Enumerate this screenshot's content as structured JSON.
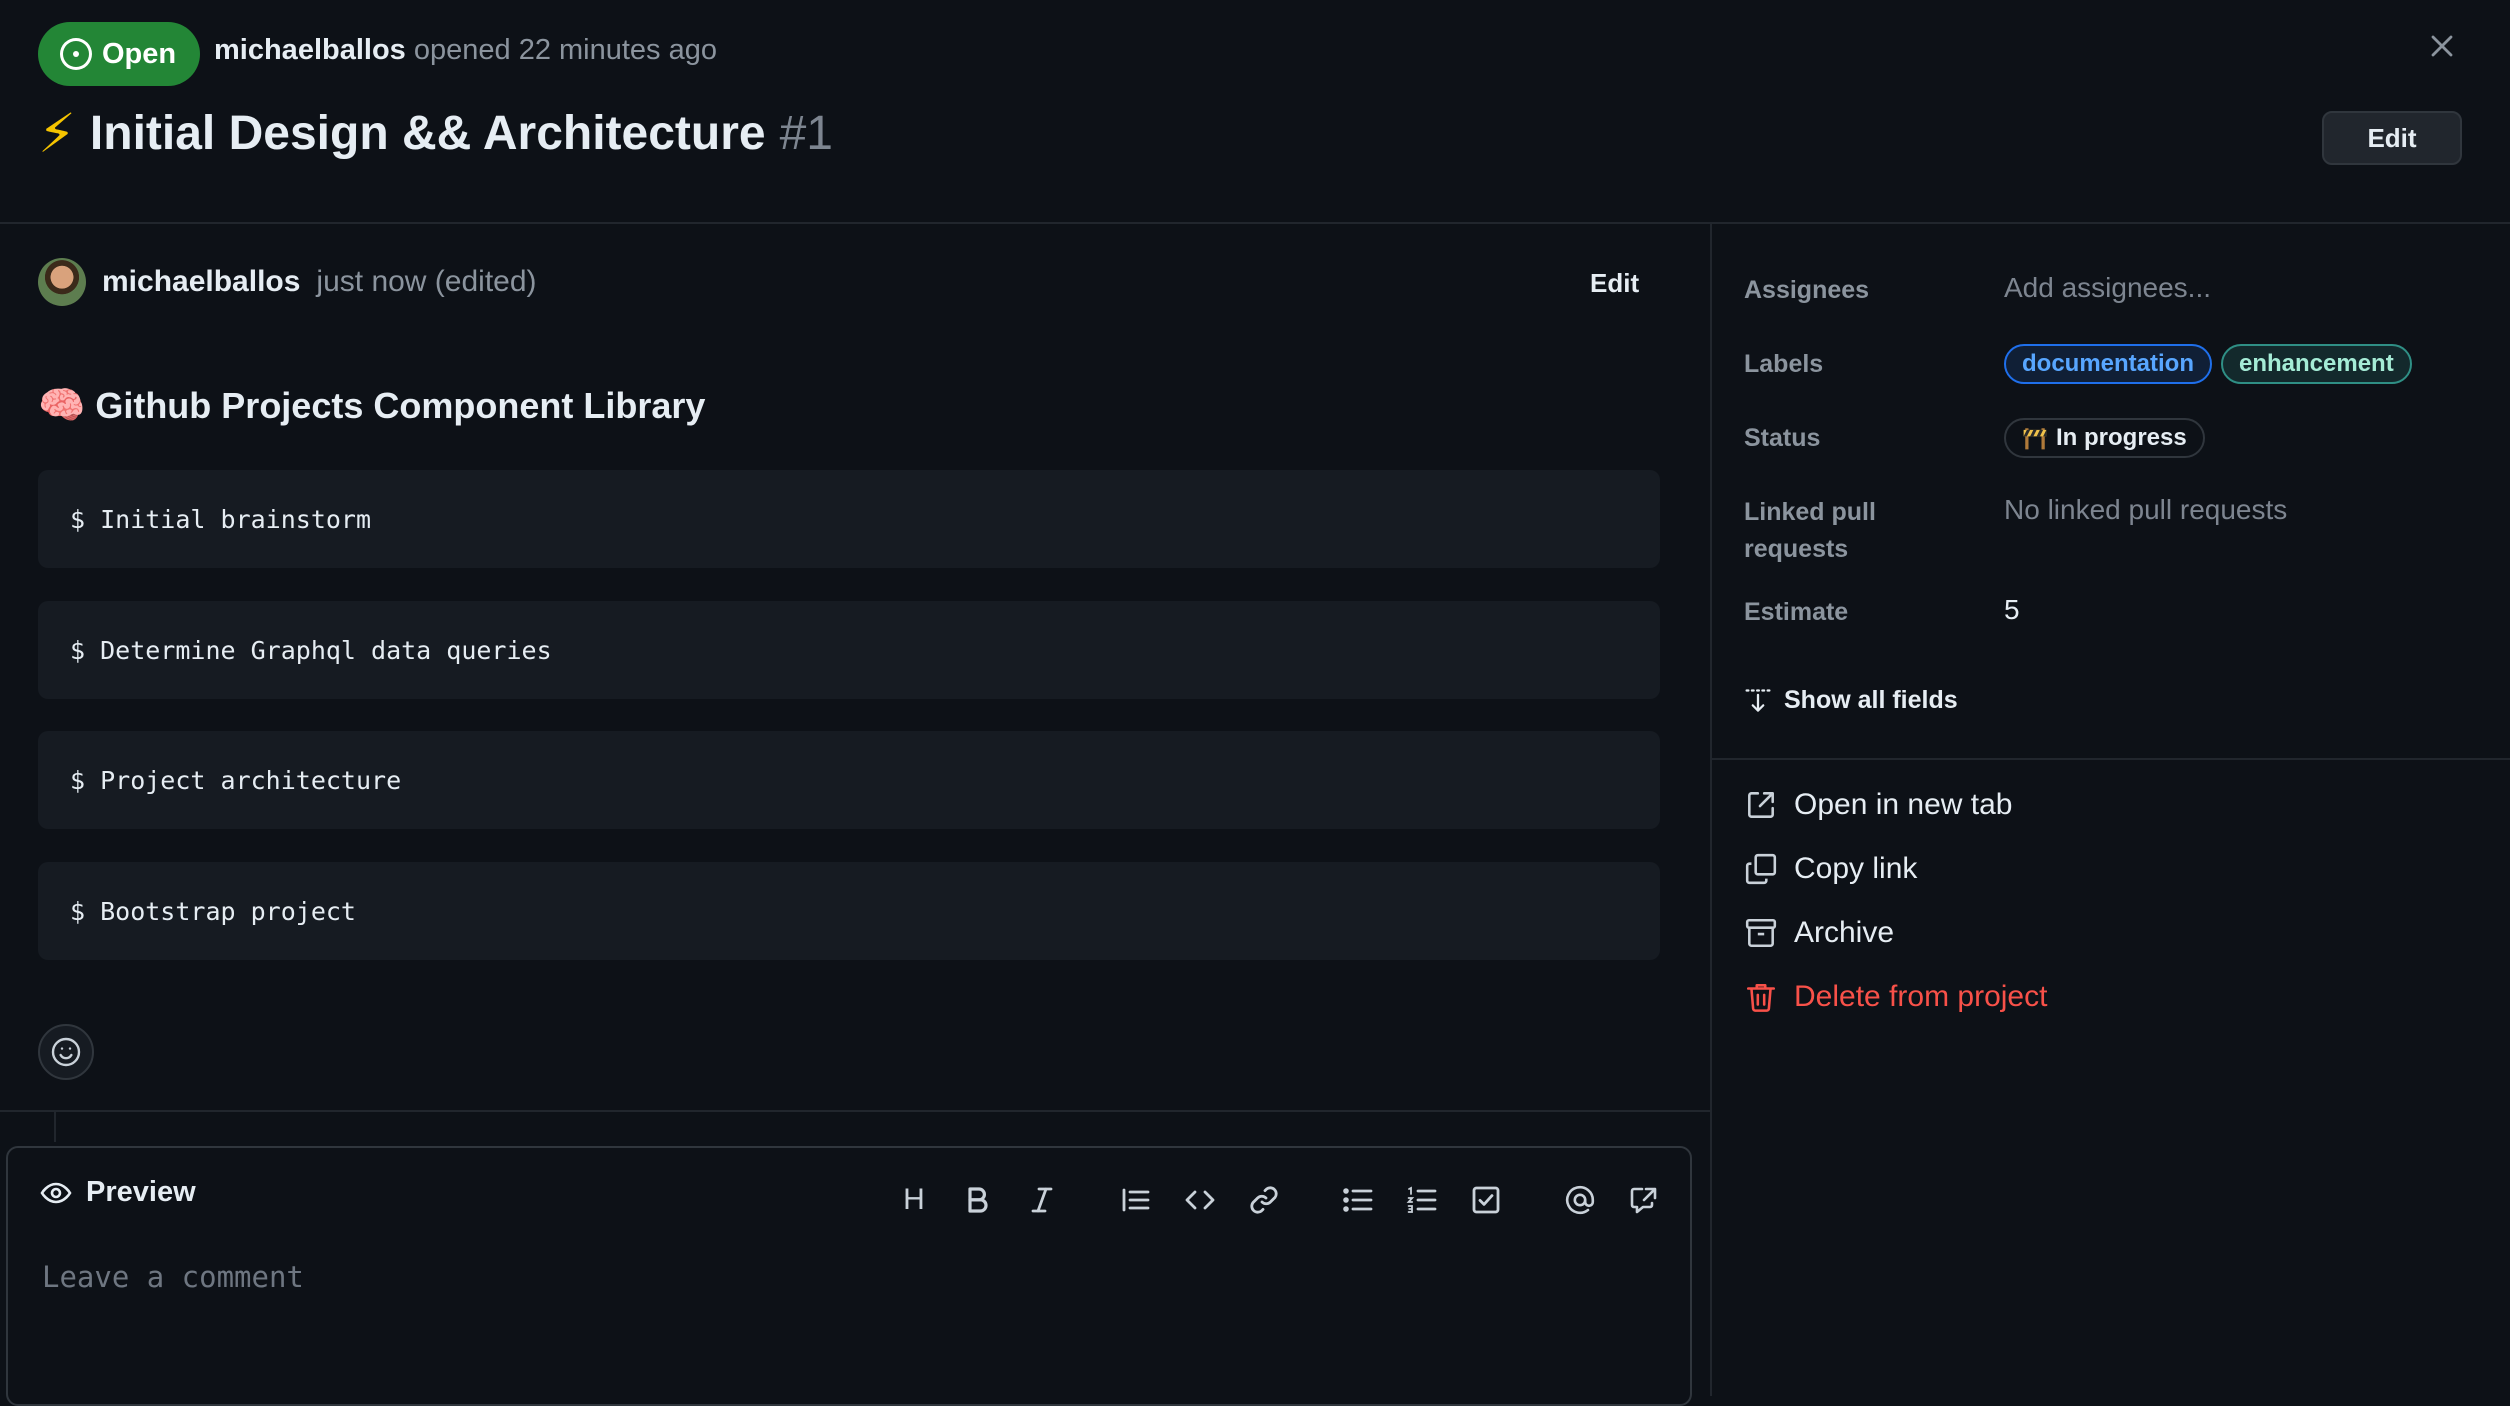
{
  "header": {
    "state_label": "Open",
    "author": "michaelballos",
    "opened_text": "opened 22 minutes ago",
    "title_emoji": "⚡",
    "title": "Initial Design && Architecture",
    "number": "#1",
    "edit_label": "Edit"
  },
  "comment": {
    "author": "michaelballos",
    "time": "just now (edited)",
    "edit_label": "Edit",
    "heading_emoji": "🧠",
    "heading": "Github Projects Component Library",
    "code_lines": [
      "$ Initial brainstorm",
      "$ Determine Graphql data queries",
      "$ Project architecture",
      "$ Bootstrap project"
    ]
  },
  "composer": {
    "preview_label": "Preview",
    "heading_tool": "H",
    "placeholder": "Leave a comment"
  },
  "sidebar": {
    "fields": {
      "assignees_label": "Assignees",
      "assignees_value": "Add assignees...",
      "labels_label": "Labels",
      "labels": [
        "documentation",
        "enhancement"
      ],
      "status_label": "Status",
      "status_value": "In progress",
      "linked_label_1": "Linked pull",
      "linked_label_2": "requests",
      "linked_value": "No linked pull requests",
      "estimate_label": "Estimate",
      "estimate_value": "5"
    },
    "show_all_label": "Show all fields",
    "actions": {
      "open_new_tab": "Open in new tab",
      "copy_link": "Copy link",
      "archive": "Archive",
      "delete": "Delete from project"
    }
  },
  "colors": {
    "background": "#0d1117",
    "open_badge": "#238636",
    "danger": "#f85149",
    "link_blue": "#58a6ff"
  }
}
